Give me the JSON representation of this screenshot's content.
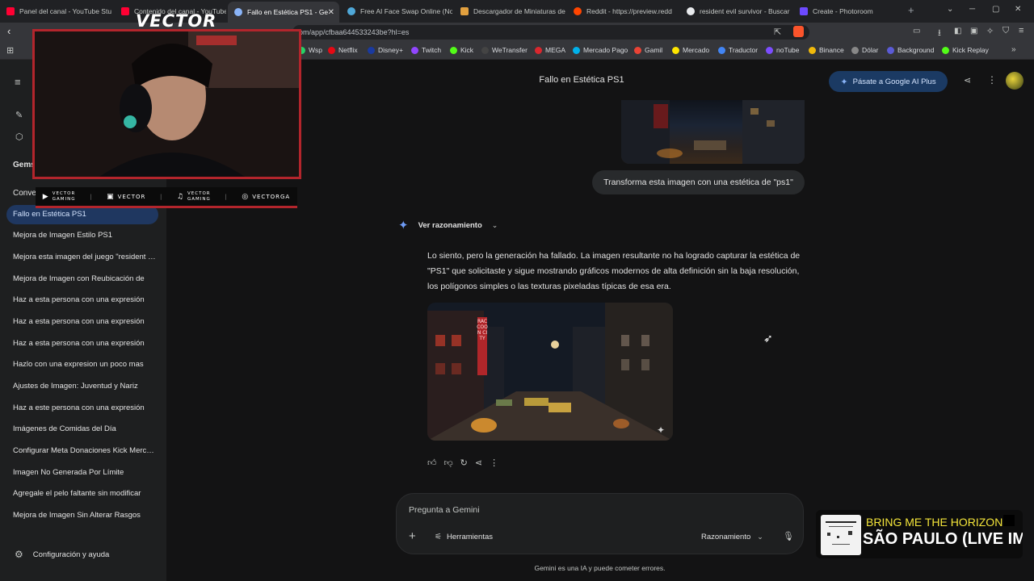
{
  "tabs": [
    {
      "label": "Panel del canal - YouTube Stu",
      "color": "#ff0033"
    },
    {
      "label": "Contenido del canal - YouTube",
      "color": "#ff0033"
    },
    {
      "label": "Fallo en Estética PS1 - Ge",
      "color": "#8ab4f8"
    },
    {
      "label": "Free AI Face Swap Online (No",
      "color": "#4fa8d8"
    },
    {
      "label": "Descargador de Miniaturas de",
      "color": "#e2a03f"
    },
    {
      "label": "Reddit - https://preview.redd",
      "color": "#ff4500"
    },
    {
      "label": "resident evil survivor - Buscar",
      "color": "#e8eaed"
    },
    {
      "label": "Create - Photoroom",
      "color": "#6d4aff"
    }
  ],
  "url": "om/app/cfbaa644533243be?hl=es",
  "bookmarks": [
    {
      "label": "Wsp",
      "color": "#25d366"
    },
    {
      "label": "Netflix",
      "color": "#e50914"
    },
    {
      "label": "Disney+",
      "color": "#1a3aa0"
    },
    {
      "label": "Twitch",
      "color": "#9146ff"
    },
    {
      "label": "Kick",
      "color": "#53fc18"
    },
    {
      "label": "WeTransfer",
      "color": "#444444"
    },
    {
      "label": "MEGA",
      "color": "#d9272e"
    },
    {
      "label": "Mercado Pago",
      "color": "#00b1ea"
    },
    {
      "label": "Gamil",
      "color": "#ea4335"
    },
    {
      "label": "Mercado",
      "color": "#ffe600"
    },
    {
      "label": "Traductor",
      "color": "#4285f4"
    },
    {
      "label": "noTube",
      "color": "#7c4dff"
    },
    {
      "label": "Binance",
      "color": "#f0b90b"
    },
    {
      "label": "Dólar",
      "color": "#888888"
    },
    {
      "label": "Background",
      "color": "#5b5bd6"
    },
    {
      "label": "Kick Replay",
      "color": "#53fc18"
    }
  ],
  "sidebar": {
    "gems_label": "Gems",
    "conversations_label": "Conve",
    "items": [
      "Fallo en Estética PS1",
      "Mejora de Imagen Estilo PS1",
      "Mejora esta imagen del juego \"resident evil\"",
      "Mejora de Imagen con Reubicación de",
      "Haz a esta persona con una expresión",
      "Haz a esta persona con una expresión",
      "Haz a esta persona con una expresión",
      "Hazlo con una expresion un poco mas",
      "Ajustes de Imagen: Juventud y Nariz",
      "Haz a este persona con una expresión",
      "Imágenes de Comidas del Día",
      "Configurar Meta Donaciones Kick Mercado",
      "Imagen No Generada Por Límite",
      "Agregale el pelo faltante sin modificar",
      "Mejora de Imagen Sin Alterar Rasgos"
    ],
    "settings_label": "Configuración y ayuda"
  },
  "header": {
    "title": "Fallo en Estética PS1",
    "upgrade_label": "Pásate a Google AI Plus"
  },
  "chat": {
    "user_message": "Transforma esta imagen con una estética de \"ps1\"",
    "reasoning_label": "Ver razonamiento",
    "answer": "Lo siento, pero la generación ha fallado. La imagen resultante no ha logrado capturar la estética de \"PS1\" que solicitaste y sigue mostrando gráficos modernos de alta definición sin la baja resolución, los polígonos simples o las texturas pixeladas típicas de esa era.",
    "sign_text": "RACCOON CITY"
  },
  "input": {
    "placeholder": "Pregunta a Gemini",
    "tools_label": "Herramientas",
    "mode_label": "Razonamiento"
  },
  "disclaimer": "Gemini es una IA y puede cometer errores.",
  "overlay": {
    "logo": "VECTOR",
    "socials": [
      "GAMING",
      "VECTOR",
      "GAMING",
      "VECTORGA"
    ],
    "social_prefix": "VECTOR",
    "song_title": "BRING ME THE HORIZON",
    "song_subtitle": "SÃO PAULO (LIVE IMM"
  },
  "colors": {
    "accent": "#8ab4f8",
    "overlay_red": "#b3252c",
    "song_yellow": "#f5e63a"
  }
}
